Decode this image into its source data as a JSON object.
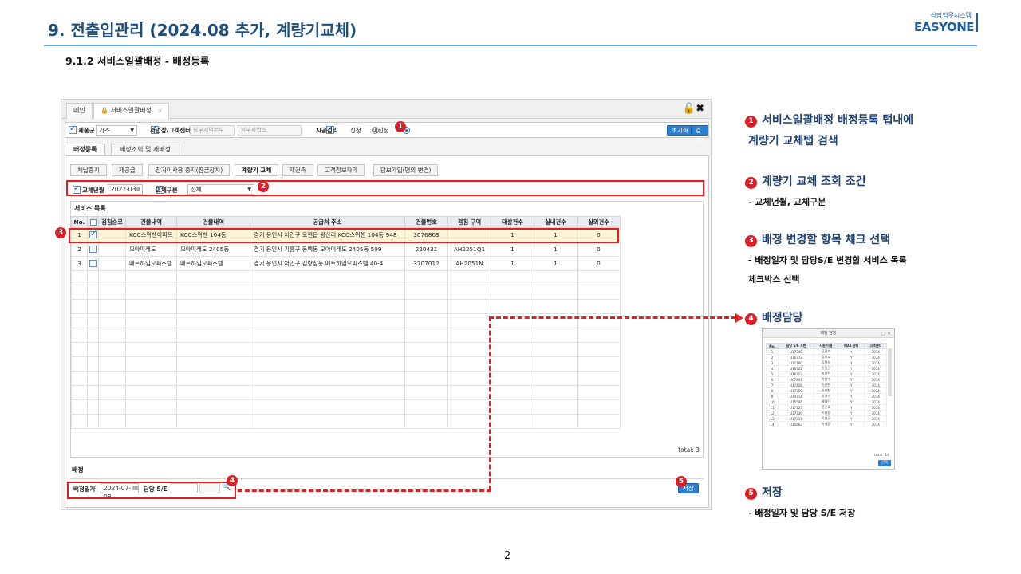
{
  "slide": {
    "title": "9. 전출입관리 (2024.08 추가, 계량기교체)",
    "subtitle": "9.1.2 서비스일괄배정 - 배정등록",
    "page_number": "2",
    "logo_small": "상담업무시스템",
    "logo_big": "EASYONE"
  },
  "app": {
    "tabs": [
      {
        "label": "메인"
      },
      {
        "label": "서비스일괄배정",
        "close": "x"
      }
    ],
    "window_icons": "🔓✖",
    "search": {
      "product_group_label": "제품군",
      "product_group_value": "가스",
      "office_label": "사업장/고객센터",
      "office_placeholder_1": "남부지역본부",
      "office_placeholder_2": "남부사업소",
      "supply_label": "시공검리",
      "radio_apply": "신청",
      "radio_not_apply": "미신청",
      "reset_button": "초기화",
      "search_button": "검색"
    },
    "sub_tabs": [
      "배정등록",
      "배정조회 및 재배정"
    ],
    "inner_tabs": [
      "체납중지",
      "재공급",
      "장기미사용 중지(잠금장치)",
      "계량기 교체",
      "재건축",
      "고객정보파악",
      "담보가입(명의 변경)"
    ],
    "filter": {
      "month_label": "교체년월",
      "month_value": "2022-03",
      "type_label": "교체구분",
      "type_value": "전체"
    },
    "grid": {
      "title": "서비스 목록",
      "columns": [
        "No.",
        "",
        "검침순로",
        "건물내역",
        "건물내역",
        "공급처 주소",
        "건물번호",
        "검침 구역",
        "대상건수",
        "실내건수",
        "실외건수"
      ],
      "rows": [
        {
          "no": "1",
          "checked": true,
          "route": "",
          "bld1": "KCC스위첸아파트",
          "bld2": "KCC스위첸 104동",
          "addr": "경기 용인시 처인구 모현읍 왕산리 KCC스위첸 104동 948",
          "bld_no": "3076803",
          "zone": "",
          "target": "1",
          "indoor": "1",
          "outdoor": "0"
        },
        {
          "no": "2",
          "checked": false,
          "route": "",
          "bld1": "모아미래도",
          "bld2": "모아미래도 2405동",
          "addr": "경기 용인시 기흥구 동백동 모아미래도 2405동 599",
          "bld_no": "220431",
          "zone": "AH2251Q1",
          "target": "1",
          "indoor": "1",
          "outdoor": "0"
        },
        {
          "no": "3",
          "checked": false,
          "route": "",
          "bld1": "메트하임오피스텔",
          "bld2": "메트하임오피스텔",
          "addr": "경기 용인시 처인구 김량장동 메트하임오피스텔 40-4",
          "bld_no": "3707012",
          "zone": "AH2051N",
          "target": "1",
          "indoor": "1",
          "outdoor": "0"
        }
      ],
      "total": "total: 3"
    },
    "assign": {
      "title": "배정",
      "date_label": "배정일자",
      "date_value": "2024-07-08",
      "se_label": "담당 S/E",
      "save_button": "저장"
    }
  },
  "badges": [
    "1",
    "2",
    "3",
    "4",
    "5"
  ],
  "descriptions": [
    {
      "title": "서비스일괄배정 배정등록 탭내에",
      "title2": "계량기 교체탭 검색"
    },
    {
      "title": "계량기 교체 조회 조건",
      "sub": "- 교체년월, 교체구분"
    },
    {
      "title": "배정 변경할 항목 체크 선택",
      "sub": "- 배정일자 및 담당S/E 변경할 서비스 목록",
      "sub2": "체크박스 선택"
    },
    {
      "title": "배정담당"
    },
    {
      "title": "저장",
      "sub": "- 배정일자 및 담당 S/E 저장"
    }
  ],
  "mini_popup": {
    "title": "배정 담당",
    "columns": [
      "No.",
      "담당 S/E 사번",
      "사원 이름",
      "PDA 상태",
      "고객센터"
    ],
    "rows": [
      [
        "1",
        "U17349",
        "금진호",
        "Y",
        "3074"
      ],
      [
        "2",
        "U16772",
        "김영호",
        "Y",
        "3074"
      ],
      [
        "3",
        "U11190",
        "김용희",
        "Y",
        "3074"
      ],
      [
        "4",
        "U16722",
        "민정근",
        "Y",
        "3074"
      ],
      [
        "5",
        "U16723",
        "박정선",
        "Y",
        "3074"
      ],
      [
        "6",
        "U07441",
        "박찬수",
        "Y",
        "3074"
      ],
      [
        "7",
        "U17428",
        "신상현",
        "Y",
        "3074"
      ],
      [
        "8",
        "U17350",
        "신상현",
        "Y",
        "3074"
      ],
      [
        "9",
        "U14714",
        "양영수",
        "Y",
        "3074"
      ],
      [
        "10",
        "U15506",
        "예명진",
        "Y",
        "3074"
      ],
      [
        "11",
        "U17123",
        "윤근호",
        "Y",
        "3074"
      ],
      [
        "12",
        "U17336",
        "이용환",
        "Y",
        "3074"
      ],
      [
        "13",
        "U17337",
        "이인규",
        "Y",
        "3074"
      ],
      [
        "14",
        "U15662",
        "이계환",
        "Y",
        "3074"
      ]
    ],
    "total": "total: 14",
    "button": "선택"
  }
}
